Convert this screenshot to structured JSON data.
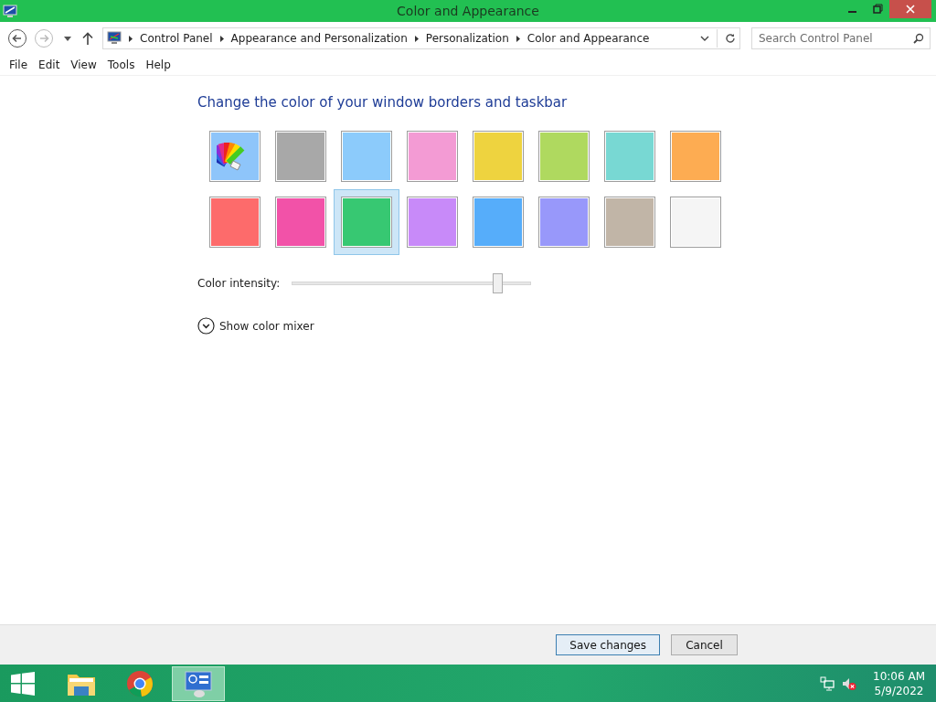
{
  "window": {
    "title": "Color and Appearance"
  },
  "breadcrumbs": [
    "Control Panel",
    "Appearance and Personalization",
    "Personalization",
    "Color and Appearance"
  ],
  "search": {
    "placeholder": "Search Control Panel"
  },
  "menu": [
    "File",
    "Edit",
    "View",
    "Tools",
    "Help"
  ],
  "heading": "Change the color of your window borders and taskbar",
  "swatches": [
    {
      "kind": "automatic",
      "selected": false
    },
    {
      "kind": "color",
      "color": "#a8a8a8",
      "selected": false
    },
    {
      "kind": "color",
      "color": "#8ccbfb",
      "selected": false
    },
    {
      "kind": "color",
      "color": "#f39bd4",
      "selected": false
    },
    {
      "kind": "color",
      "color": "#eed33f",
      "selected": false
    },
    {
      "kind": "color",
      "color": "#afd95f",
      "selected": false
    },
    {
      "kind": "color",
      "color": "#78d8d3",
      "selected": false
    },
    {
      "kind": "color",
      "color": "#fdac52",
      "selected": false
    },
    {
      "kind": "color",
      "color": "#fd6b6b",
      "selected": false
    },
    {
      "kind": "color",
      "color": "#f252a8",
      "selected": false
    },
    {
      "kind": "color",
      "color": "#37c872",
      "selected": true
    },
    {
      "kind": "color",
      "color": "#c88af9",
      "selected": false
    },
    {
      "kind": "color",
      "color": "#56adfa",
      "selected": false
    },
    {
      "kind": "color",
      "color": "#9898fa",
      "selected": false
    },
    {
      "kind": "color",
      "color": "#c1b5a7",
      "selected": false
    },
    {
      "kind": "color",
      "color": "#f5f5f5",
      "selected": false
    }
  ],
  "intensity": {
    "label": "Color intensity:",
    "level": 0.86
  },
  "mixer": {
    "label": "Show color mixer",
    "expanded": false
  },
  "buttons": [
    "Save changes",
    "Cancel"
  ],
  "taskbar": {
    "apps": [
      {
        "kind": "explorer",
        "active": false
      },
      {
        "kind": "browser",
        "active": false
      },
      {
        "kind": "control-panel",
        "active": true
      }
    ],
    "time": "10:06 AM",
    "date": "5/9/2022"
  }
}
